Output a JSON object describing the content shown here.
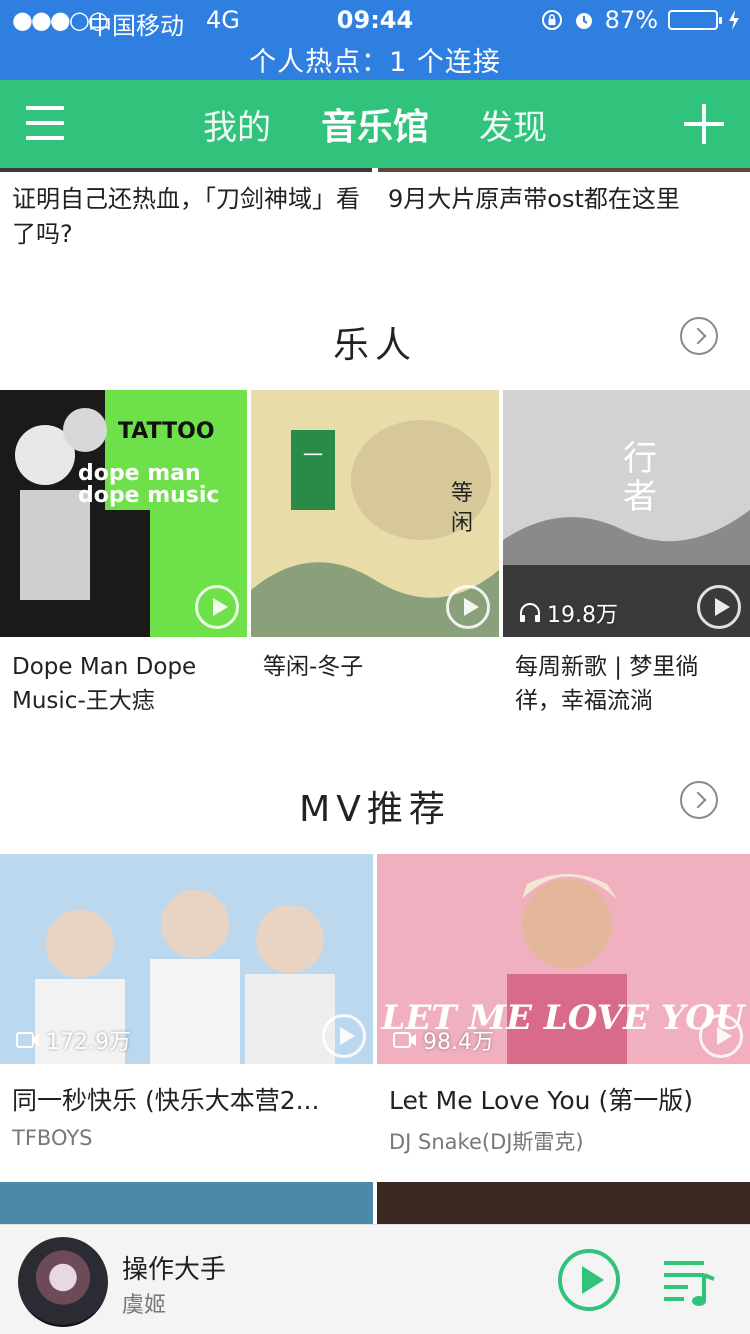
{
  "status_bar": {
    "signal": "●●●○○",
    "carrier": "中国移动",
    "network": "4G",
    "time": "09:44",
    "battery": "87%",
    "battery_level": 0.87,
    "hotspot": "个人热点：1 个连接"
  },
  "nav": {
    "tabs": [
      {
        "label": "我的"
      },
      {
        "label": "音乐馆"
      },
      {
        "label": "发现"
      }
    ],
    "active_tab": "音乐馆"
  },
  "top_cards": [
    {
      "caption": "证明自己还热血，「刀剑神域」看了吗?"
    },
    {
      "caption": "9月大片原声带ost都在这里"
    }
  ],
  "yueren": {
    "title": "乐人",
    "items": [
      {
        "caption": "Dope Man Dope Music-王大痣",
        "cover_colors": [
          "#6de04a",
          "#1a1a1a"
        ]
      },
      {
        "caption": "等闲-冬子",
        "cover_colors": [
          "#e8dca8",
          "#6a8a5a"
        ]
      },
      {
        "caption": "每周新歌 | 梦里徜徉，幸福流淌",
        "play_count": "19.8万",
        "cover_colors": [
          "#c9c9c9",
          "#444444"
        ]
      }
    ]
  },
  "mv": {
    "title": "MV推荐",
    "items": [
      {
        "caption": "同一秒快乐 (快乐大本营2...",
        "artist": "TFBOYS",
        "play_count": "172.9万",
        "cover_colors": [
          "#bcd8ee",
          "#f2f2f2"
        ]
      },
      {
        "caption": "Let Me Love You (第一版)",
        "artist": "DJ Snake(DJ斯雷克)",
        "play_count": "98.4万",
        "overlay_text": "LET ME LOVE YOU",
        "cover_colors": [
          "#f0b0c0",
          "#d86a8a"
        ]
      }
    ]
  },
  "player": {
    "song": "操作大手",
    "artist": "虞姬"
  },
  "colors": {
    "status_bar_bg": "#2f7fe0",
    "brand_green": "#31c27c"
  }
}
